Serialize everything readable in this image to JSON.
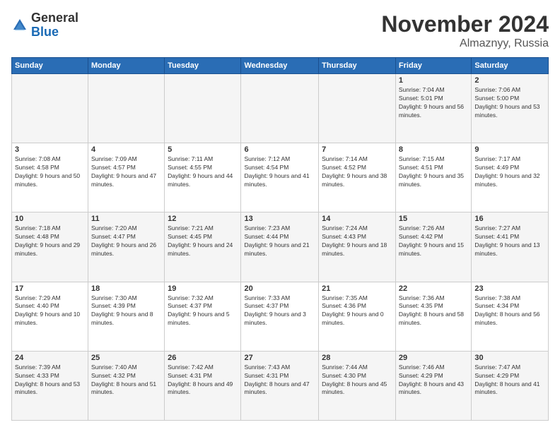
{
  "logo": {
    "general": "General",
    "blue": "Blue"
  },
  "header": {
    "month": "November 2024",
    "location": "Almaznyy, Russia"
  },
  "weekdays": [
    "Sunday",
    "Monday",
    "Tuesday",
    "Wednesday",
    "Thursday",
    "Friday",
    "Saturday"
  ],
  "weeks": [
    [
      {
        "day": "",
        "info": ""
      },
      {
        "day": "",
        "info": ""
      },
      {
        "day": "",
        "info": ""
      },
      {
        "day": "",
        "info": ""
      },
      {
        "day": "",
        "info": ""
      },
      {
        "day": "1",
        "info": "Sunrise: 7:04 AM\nSunset: 5:01 PM\nDaylight: 9 hours and 56 minutes."
      },
      {
        "day": "2",
        "info": "Sunrise: 7:06 AM\nSunset: 5:00 PM\nDaylight: 9 hours and 53 minutes."
      }
    ],
    [
      {
        "day": "3",
        "info": "Sunrise: 7:08 AM\nSunset: 4:58 PM\nDaylight: 9 hours and 50 minutes."
      },
      {
        "day": "4",
        "info": "Sunrise: 7:09 AM\nSunset: 4:57 PM\nDaylight: 9 hours and 47 minutes."
      },
      {
        "day": "5",
        "info": "Sunrise: 7:11 AM\nSunset: 4:55 PM\nDaylight: 9 hours and 44 minutes."
      },
      {
        "day": "6",
        "info": "Sunrise: 7:12 AM\nSunset: 4:54 PM\nDaylight: 9 hours and 41 minutes."
      },
      {
        "day": "7",
        "info": "Sunrise: 7:14 AM\nSunset: 4:52 PM\nDaylight: 9 hours and 38 minutes."
      },
      {
        "day": "8",
        "info": "Sunrise: 7:15 AM\nSunset: 4:51 PM\nDaylight: 9 hours and 35 minutes."
      },
      {
        "day": "9",
        "info": "Sunrise: 7:17 AM\nSunset: 4:49 PM\nDaylight: 9 hours and 32 minutes."
      }
    ],
    [
      {
        "day": "10",
        "info": "Sunrise: 7:18 AM\nSunset: 4:48 PM\nDaylight: 9 hours and 29 minutes."
      },
      {
        "day": "11",
        "info": "Sunrise: 7:20 AM\nSunset: 4:47 PM\nDaylight: 9 hours and 26 minutes."
      },
      {
        "day": "12",
        "info": "Sunrise: 7:21 AM\nSunset: 4:45 PM\nDaylight: 9 hours and 24 minutes."
      },
      {
        "day": "13",
        "info": "Sunrise: 7:23 AM\nSunset: 4:44 PM\nDaylight: 9 hours and 21 minutes."
      },
      {
        "day": "14",
        "info": "Sunrise: 7:24 AM\nSunset: 4:43 PM\nDaylight: 9 hours and 18 minutes."
      },
      {
        "day": "15",
        "info": "Sunrise: 7:26 AM\nSunset: 4:42 PM\nDaylight: 9 hours and 15 minutes."
      },
      {
        "day": "16",
        "info": "Sunrise: 7:27 AM\nSunset: 4:41 PM\nDaylight: 9 hours and 13 minutes."
      }
    ],
    [
      {
        "day": "17",
        "info": "Sunrise: 7:29 AM\nSunset: 4:40 PM\nDaylight: 9 hours and 10 minutes."
      },
      {
        "day": "18",
        "info": "Sunrise: 7:30 AM\nSunset: 4:39 PM\nDaylight: 9 hours and 8 minutes."
      },
      {
        "day": "19",
        "info": "Sunrise: 7:32 AM\nSunset: 4:37 PM\nDaylight: 9 hours and 5 minutes."
      },
      {
        "day": "20",
        "info": "Sunrise: 7:33 AM\nSunset: 4:37 PM\nDaylight: 9 hours and 3 minutes."
      },
      {
        "day": "21",
        "info": "Sunrise: 7:35 AM\nSunset: 4:36 PM\nDaylight: 9 hours and 0 minutes."
      },
      {
        "day": "22",
        "info": "Sunrise: 7:36 AM\nSunset: 4:35 PM\nDaylight: 8 hours and 58 minutes."
      },
      {
        "day": "23",
        "info": "Sunrise: 7:38 AM\nSunset: 4:34 PM\nDaylight: 8 hours and 56 minutes."
      }
    ],
    [
      {
        "day": "24",
        "info": "Sunrise: 7:39 AM\nSunset: 4:33 PM\nDaylight: 8 hours and 53 minutes."
      },
      {
        "day": "25",
        "info": "Sunrise: 7:40 AM\nSunset: 4:32 PM\nDaylight: 8 hours and 51 minutes."
      },
      {
        "day": "26",
        "info": "Sunrise: 7:42 AM\nSunset: 4:31 PM\nDaylight: 8 hours and 49 minutes."
      },
      {
        "day": "27",
        "info": "Sunrise: 7:43 AM\nSunset: 4:31 PM\nDaylight: 8 hours and 47 minutes."
      },
      {
        "day": "28",
        "info": "Sunrise: 7:44 AM\nSunset: 4:30 PM\nDaylight: 8 hours and 45 minutes."
      },
      {
        "day": "29",
        "info": "Sunrise: 7:46 AM\nSunset: 4:29 PM\nDaylight: 8 hours and 43 minutes."
      },
      {
        "day": "30",
        "info": "Sunrise: 7:47 AM\nSunset: 4:29 PM\nDaylight: 8 hours and 41 minutes."
      }
    ]
  ]
}
